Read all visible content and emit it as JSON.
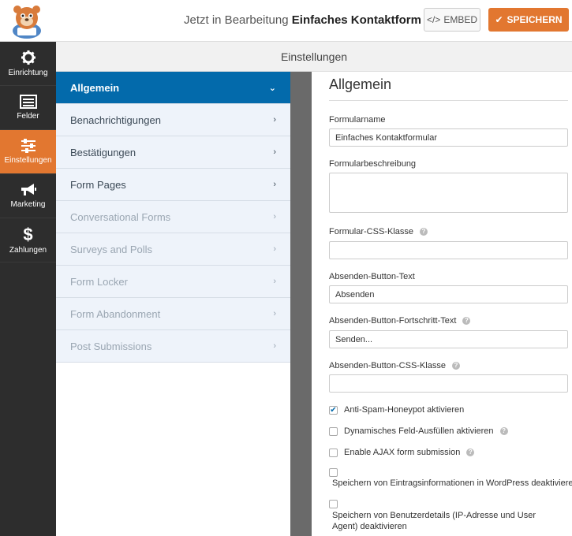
{
  "header": {
    "title_prefix": "Jetzt in Bearbeitung",
    "title_form": "Einfaches Kontaktformular",
    "embed_label": "EMBED",
    "save_label": "SPEICHERN"
  },
  "sidebar": {
    "items": [
      {
        "label": "Einrichtung",
        "icon": "gear-icon"
      },
      {
        "label": "Felder",
        "icon": "fields-icon"
      },
      {
        "label": "Einstellungen",
        "icon": "sliders-icon",
        "active": true
      },
      {
        "label": "Marketing",
        "icon": "megaphone-icon"
      },
      {
        "label": "Zahlungen",
        "icon": "dollar-icon"
      }
    ]
  },
  "topbar": {
    "title": "Einstellungen"
  },
  "sections": [
    {
      "label": "Allgemein",
      "active": true
    },
    {
      "label": "Benachrichtigungen"
    },
    {
      "label": "Bestätigungen"
    },
    {
      "label": "Form Pages"
    },
    {
      "label": "Conversational Forms",
      "dim": true
    },
    {
      "label": "Surveys and Polls",
      "dim": true
    },
    {
      "label": "Form Locker",
      "dim": true
    },
    {
      "label": "Form Abandonment",
      "dim": true
    },
    {
      "label": "Post Submissions",
      "dim": true
    }
  ],
  "general": {
    "title": "Allgemein",
    "form_name_label": "Formularname",
    "form_name_value": "Einfaches Kontaktformular",
    "form_desc_label": "Formularbeschreibung",
    "css_class_label": "Formular-CSS-Klasse",
    "submit_text_label": "Absenden-Button-Text",
    "submit_text_value": "Absenden",
    "submit_progress_label": "Absenden-Button-Fortschritt-Text",
    "submit_progress_value": "Senden...",
    "submit_css_label": "Absenden-Button-CSS-Klasse",
    "honeypot_label": "Anti-Spam-Honeypot aktivieren",
    "dynamic_label": "Dynamisches Feld-Ausfüllen aktivieren",
    "ajax_label": "Enable AJAX form submission",
    "store_entries_label": "Speichern von Eintragsinformationen in WordPress deaktivieren",
    "store_user_label": "Speichern von Benutzerdetails (IP-Adresse und User Agent) deaktivieren"
  },
  "colors": {
    "accent": "#e27730",
    "active_blue": "#036aab",
    "sidebar": "#2d2d2d"
  }
}
